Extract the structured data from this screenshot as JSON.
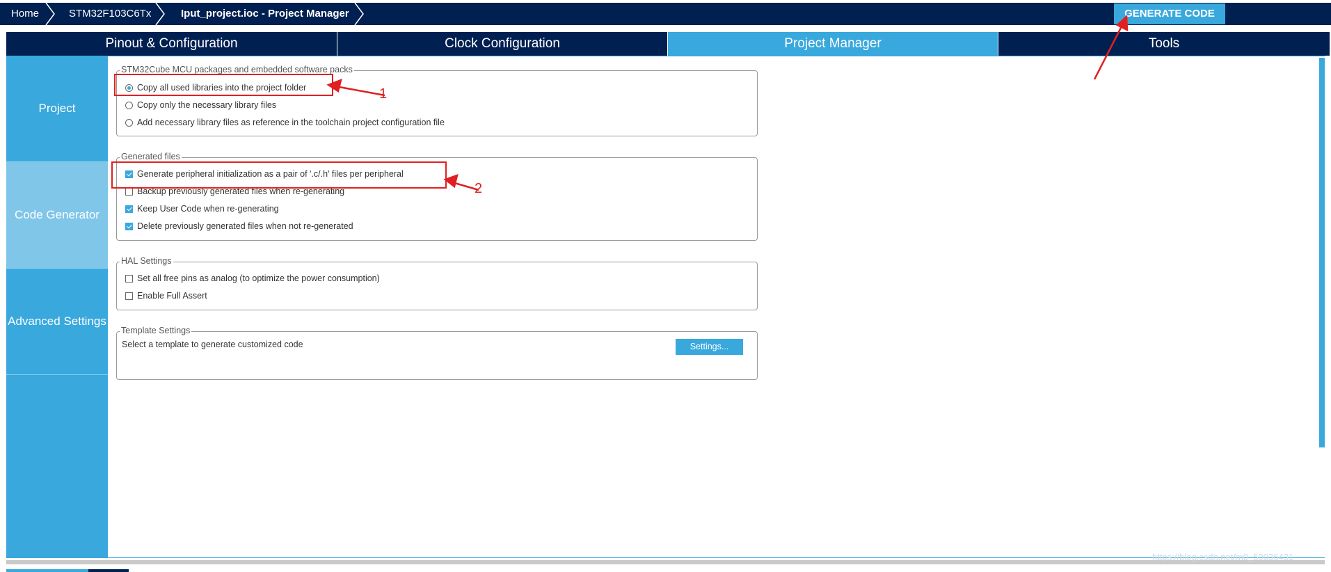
{
  "breadcrumb": {
    "home": "Home",
    "device": "STM32F103C6Tx",
    "project": "Iput_project.ioc - Project Manager"
  },
  "generate_code_label": "GENERATE CODE",
  "tabs": [
    {
      "label": "Pinout & Configuration",
      "active": false
    },
    {
      "label": "Clock Configuration",
      "active": false
    },
    {
      "label": "Project Manager",
      "active": true
    },
    {
      "label": "Tools",
      "active": false
    }
  ],
  "sidebar": {
    "items": [
      {
        "label": "Project",
        "active": false
      },
      {
        "label": "Code Generator",
        "active": true
      },
      {
        "label": "Advanced Settings",
        "active": false
      }
    ]
  },
  "packages_group": {
    "title": "STM32Cube MCU packages and embedded software packs",
    "options": [
      {
        "label": "Copy all used libraries into the project folder",
        "selected": true
      },
      {
        "label": "Copy only the necessary library files",
        "selected": false
      },
      {
        "label": "Add necessary library files as reference in the toolchain project configuration file",
        "selected": false
      }
    ]
  },
  "generated_files_group": {
    "title": "Generated files",
    "options": [
      {
        "label": "Generate peripheral initialization as a pair of '.c/.h' files per peripheral",
        "checked": true
      },
      {
        "label": "Backup previously generated files when re-generating",
        "checked": false
      },
      {
        "label": "Keep User Code when re-generating",
        "checked": true
      },
      {
        "label": "Delete previously generated files when not re-generated",
        "checked": true
      }
    ]
  },
  "hal_group": {
    "title": "HAL Settings",
    "options": [
      {
        "label": "Set all free pins as analog (to optimize the power consumption)",
        "checked": false
      },
      {
        "label": "Enable Full Assert",
        "checked": false
      }
    ]
  },
  "template_group": {
    "title": "Template Settings",
    "text": "Select a template to generate customized code",
    "button": "Settings..."
  },
  "annotations": {
    "label_1": "1",
    "label_2": "2",
    "color": "#e02020"
  },
  "watermark": "https://blog.csdn.net/m0_50036431",
  "colors": {
    "navy": "#002052",
    "accent": "#39a8dd",
    "sidebar_active": "#7fc6e9"
  }
}
